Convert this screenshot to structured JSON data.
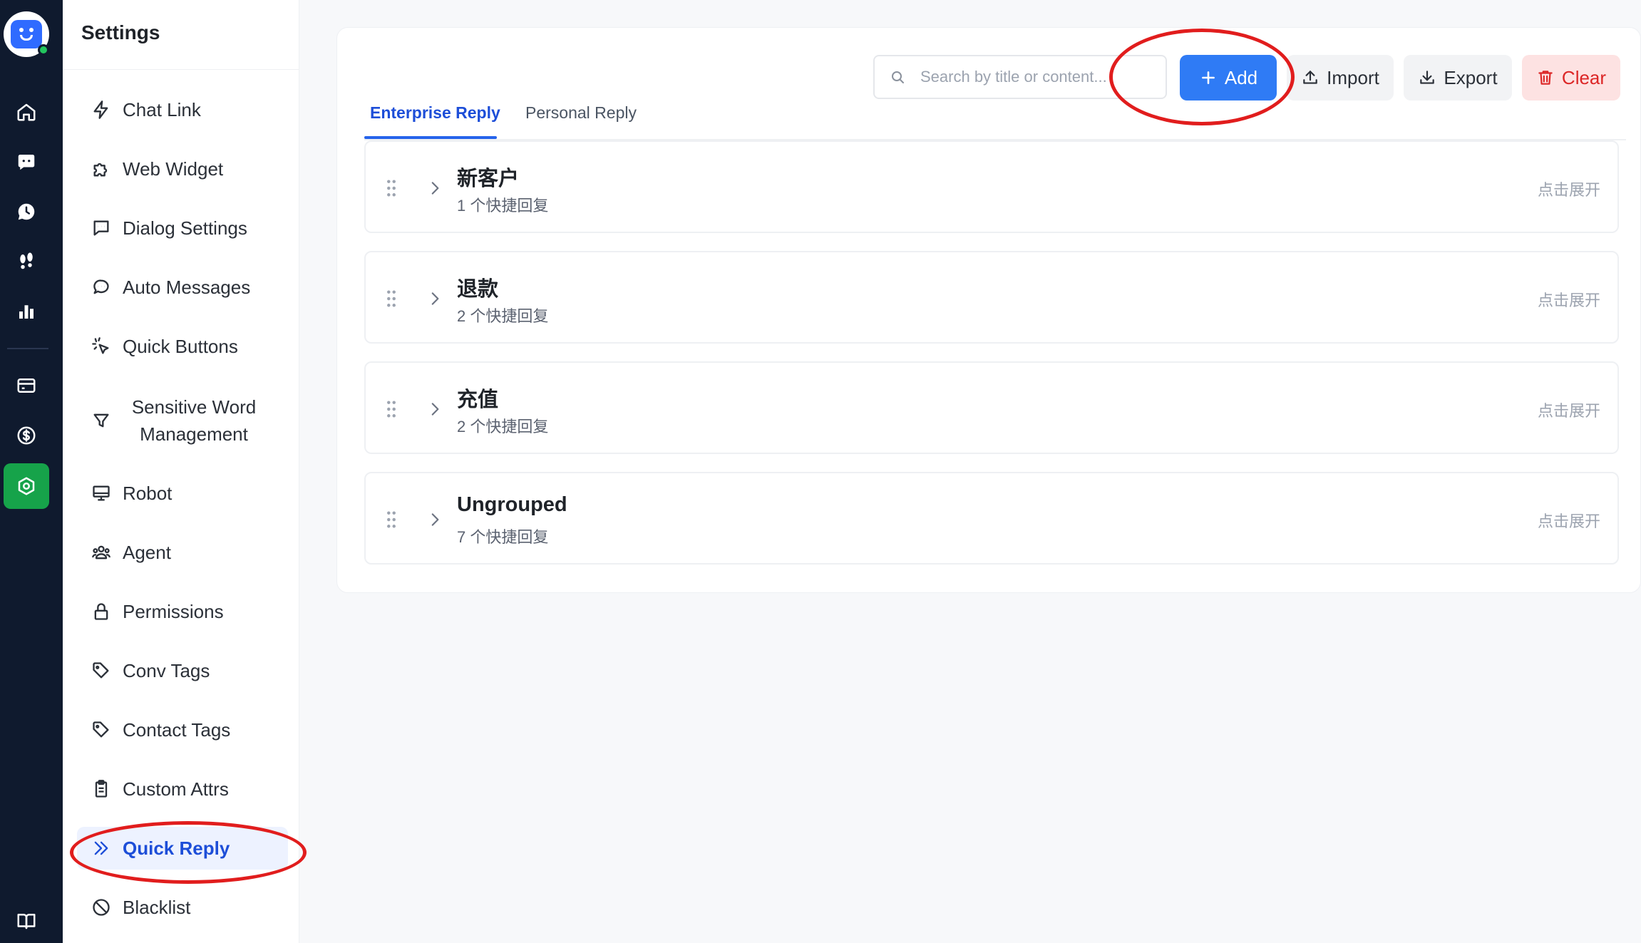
{
  "sidebar": {
    "title": "Settings",
    "items": [
      {
        "label": "Chat Link"
      },
      {
        "label": "Web Widget"
      },
      {
        "label": "Dialog Settings"
      },
      {
        "label": "Auto Messages"
      },
      {
        "label": "Quick Buttons"
      },
      {
        "label": "Sensitive Word Management"
      },
      {
        "label": "Robot"
      },
      {
        "label": "Agent"
      },
      {
        "label": "Permissions"
      },
      {
        "label": "Conv Tags"
      },
      {
        "label": "Contact Tags"
      },
      {
        "label": "Custom Attrs"
      },
      {
        "label": "Quick Reply"
      },
      {
        "label": "Blacklist"
      }
    ],
    "active": "Quick Reply"
  },
  "rail": {
    "icons": [
      "home-icon",
      "chat-icon",
      "history-icon",
      "footprints-icon",
      "bar-chart-icon",
      "billing-card-icon",
      "dollar-icon",
      "settings-hex-icon",
      "book-icon"
    ],
    "active": "settings-hex-icon"
  },
  "tabs": [
    {
      "label": "Enterprise Reply",
      "active": true
    },
    {
      "label": "Personal Reply",
      "active": false
    }
  ],
  "search": {
    "placeholder": "Search by title or content..."
  },
  "toolbar": {
    "add_label": "Add",
    "import_label": "Import",
    "export_label": "Export",
    "clear_label": "Clear"
  },
  "groups": [
    {
      "title": "新客户",
      "count": "1 个快捷回复",
      "expand": "点击展开"
    },
    {
      "title": "退款",
      "count": "2 个快捷回复",
      "expand": "点击展开"
    },
    {
      "title": "充值",
      "count": "2 个快捷回复",
      "expand": "点击展开"
    },
    {
      "title": "Ungrouped",
      "count": "7 个快捷回复",
      "expand": "点击展开"
    }
  ],
  "colors": {
    "primary": "#2f7bf5",
    "active_nav_bg": "#edf2ff",
    "active_rail": "#16a34a",
    "danger": "#dc2626",
    "annotation": "#e11d1d"
  }
}
